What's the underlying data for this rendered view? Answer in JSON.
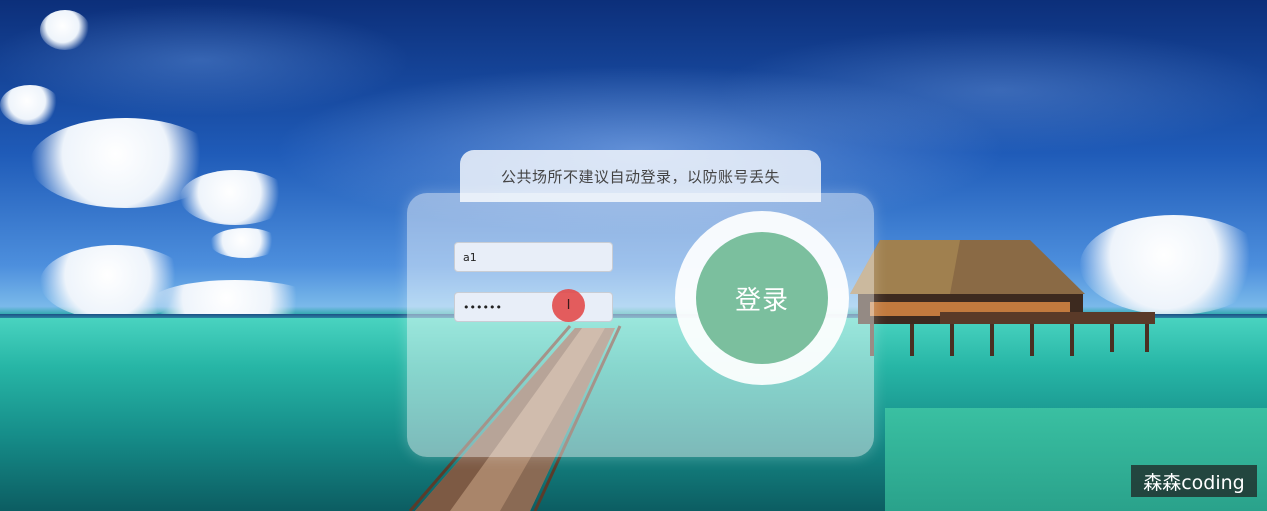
{
  "tip": {
    "text": "公共场所不建议自动登录，以防账号丢失"
  },
  "form": {
    "username_value": "a1",
    "password_value": "••••••",
    "login_label": "登录"
  },
  "cursor": {
    "glyph": "I"
  },
  "watermark": {
    "text": "森森coding"
  },
  "colors": {
    "login_button": "#7bbf9e",
    "cursor_highlight": "#e24b4b"
  }
}
